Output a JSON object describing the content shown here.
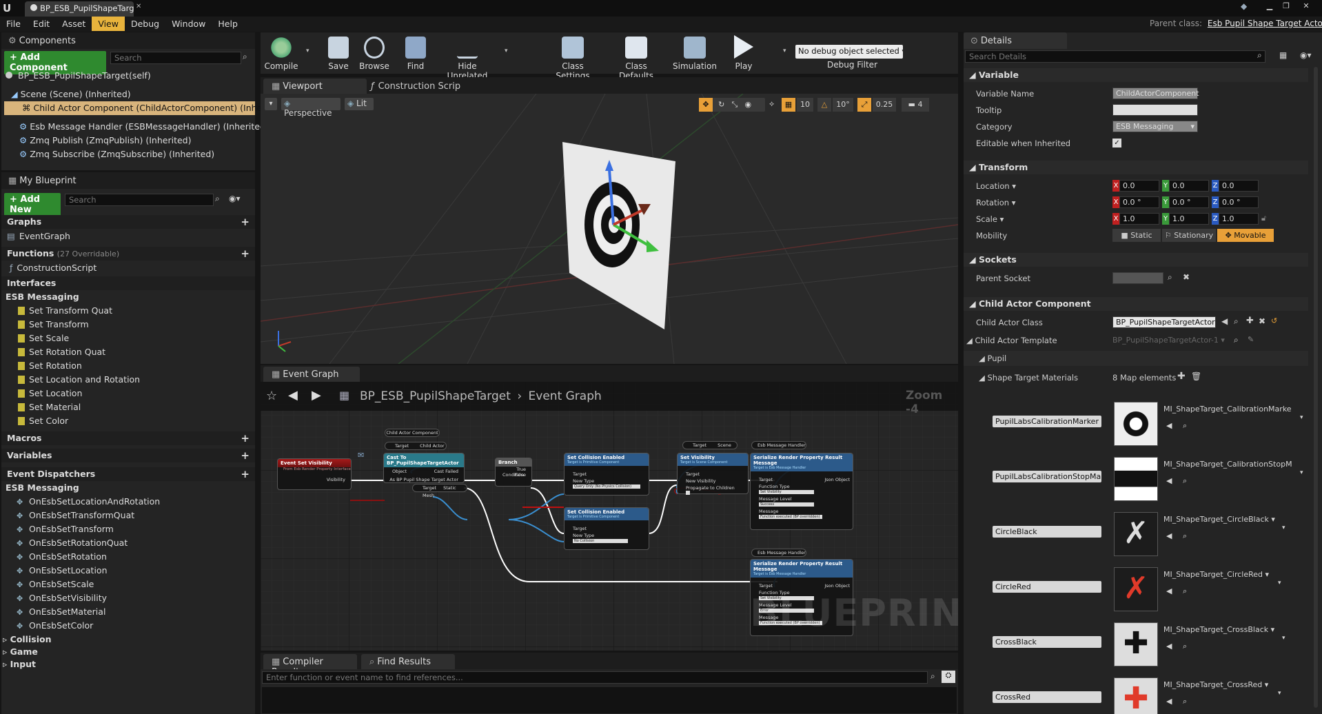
{
  "window": {
    "tab_title": "BP_ESB_PupilShapeTarget",
    "parent_class_label": "Parent class:",
    "parent_class": "Esb Pupil Shape Target Actor"
  },
  "menu": {
    "items": [
      "File",
      "Edit",
      "Asset",
      "View",
      "Debug",
      "Window",
      "Help"
    ],
    "active": "View"
  },
  "components": {
    "tab": "Components",
    "add_label": "+ Add Component",
    "search_placeholder": "Search",
    "self": "BP_ESB_PupilShapeTarget(self)",
    "items": [
      "Scene (Scene) (Inherited)",
      "Child Actor Component (ChildActorComponent) (Inherited)",
      "Esb Message Handler (ESBMessageHandler) (Inherited)",
      "Zmq Publish (ZmqPublish) (Inherited)",
      "Zmq Subscribe (ZmqSubscribe) (Inherited)"
    ]
  },
  "myblueprint": {
    "tab": "My Blueprint",
    "add_label": "+ Add New",
    "search_placeholder": "Search",
    "graphs": "Graphs",
    "event_graph": "EventGraph",
    "functions": "Functions",
    "functions_note": "(27 Overridable)",
    "construction": "ConstructionScript",
    "interfaces": "Interfaces",
    "esb_messaging": "ESB Messaging",
    "interface_fns": [
      "Set Transform Quat",
      "Set Transform",
      "Set Scale",
      "Set Rotation Quat",
      "Set Rotation",
      "Set Location and Rotation",
      "Set Location",
      "Set Material",
      "Set Color"
    ],
    "macros": "Macros",
    "variables": "Variables",
    "dispatchers": "Event Dispatchers",
    "dispatchers_group": "ESB Messaging",
    "dispatcher_items": [
      "OnEsbSetLocationAndRotation",
      "OnEsbSetTransformQuat",
      "OnEsbSetTransform",
      "OnEsbSetRotationQuat",
      "OnEsbSetRotation",
      "OnEsbSetLocation",
      "OnEsbSetScale",
      "OnEsbSetVisibility",
      "OnEsbSetMaterial",
      "OnEsbSetColor"
    ],
    "categories": [
      "Collision",
      "Game",
      "Input"
    ]
  },
  "toolbar": {
    "buttons": [
      "Compile",
      "Save",
      "Browse",
      "Find",
      "Hide Unrelated",
      "Class Settings",
      "Class Defaults",
      "Simulation",
      "Play"
    ],
    "debug_select": "No debug object selected",
    "debug_filter": "Debug Filter"
  },
  "viewport": {
    "tabs": [
      "Viewport",
      "Construction Scrip"
    ],
    "perspective": "Perspective",
    "lit": "Lit",
    "grid_snap": "10",
    "rot_snap": "10°",
    "scale_snap": "0.25",
    "cam_speed": "4"
  },
  "eventgraph": {
    "tab": "Event Graph",
    "breadcrumb_bp": "BP_ESB_PupilShapeTarget",
    "breadcrumb_graph": "Event Graph",
    "zoom": "Zoom -4",
    "watermark": "BLUEPRINT",
    "nodes": {
      "event": "Event Set Visibility",
      "event_sub": "From Esb Render Property Interface",
      "visibility": "Visibility",
      "child_actor_comp": "Child Actor Component",
      "target": "Target",
      "child_actor": "Child Actor",
      "cast": "Cast To BP_PupilShapeTargetActor",
      "object": "Object",
      "cast_failed": "Cast Failed",
      "as_bp": "As BP Pupil Shape Target Actor",
      "static_mesh": "Static Mesh",
      "branch": "Branch",
      "true": "True",
      "false": "False",
      "condition": "Condition",
      "set_collision": "Set Collision Enabled",
      "set_collision_sub": "Target is Primitive Component",
      "new_type": "New Type",
      "collision_opt1": "Query Only (No Physics Collision)",
      "collision_opt2": "No Collision",
      "scene": "Scene",
      "set_visibility": "Set Visibility",
      "set_visibility_sub": "Target is Scene Component",
      "new_visibility": "New Visibility",
      "propagate": "Propagate to Children",
      "esb_handler": "Esb Message Handler",
      "serialize": "Serialize Render Property Result Message",
      "serialize_sub": "Target is Esb Message Handler",
      "json_object": "Json Object",
      "function_type": "Function Type",
      "function_val": "Set Visibility",
      "message_level": "Message Level",
      "level_success": "Success",
      "level_error": "Error",
      "message": "Message",
      "message_val": "Function executed (BP overridden)"
    }
  },
  "bottom": {
    "tabs": [
      "Compiler Results",
      "Find Results"
    ],
    "find_placeholder": "Enter function or event name to find references..."
  },
  "details": {
    "tab": "Details",
    "search_placeholder": "Search Details",
    "variable": "Variable",
    "variable_name_lbl": "Variable Name",
    "variable_name": "ChildActorComponent",
    "tooltip_lbl": "Tooltip",
    "tooltip": "",
    "category_lbl": "Category",
    "category": "ESB Messaging",
    "editable_lbl": "Editable when Inherited",
    "transform": "Transform",
    "location_lbl": "Location",
    "rotation_lbl": "Rotation",
    "scale_lbl": "Scale",
    "mobility_lbl": "Mobility",
    "location": [
      "0.0",
      "0.0",
      "0.0"
    ],
    "rotation": [
      "0.0 °",
      "0.0 °",
      "0.0 °"
    ],
    "scale": [
      "1.0",
      "1.0",
      "1.0"
    ],
    "mobility": [
      "Static",
      "Stationary",
      "Movable"
    ],
    "sockets": "Sockets",
    "parent_socket_lbl": "Parent Socket",
    "cac_section": "Child Actor Component",
    "cac_class_lbl": "Child Actor Class",
    "cac_class": "BP_PupilShapeTargetActor",
    "cac_template_lbl": "Child Actor Template",
    "cac_template": "BP_PupilShapeTargetActor-1",
    "pupil": "Pupil",
    "stm_lbl": "Shape Target Materials",
    "stm_count": "8 Map elements",
    "materials": [
      {
        "key": "PupilLabsCalibrationMarker",
        "value": "MI_ShapeTarget_CalibrationMarke"
      },
      {
        "key": "PupilLabsCalibrationStopMark",
        "value": "MI_ShapeTarget_CalibrationStopM"
      },
      {
        "key": "CircleBlack",
        "value": "MI_ShapeTarget_CircleBlack"
      },
      {
        "key": "CircleRed",
        "value": "MI_ShapeTarget_CircleRed"
      },
      {
        "key": "CrossBlack",
        "value": "MI_ShapeTarget_CrossBlack"
      },
      {
        "key": "CrossRed",
        "value": "MI_ShapeTarget_CrossRed"
      }
    ]
  }
}
